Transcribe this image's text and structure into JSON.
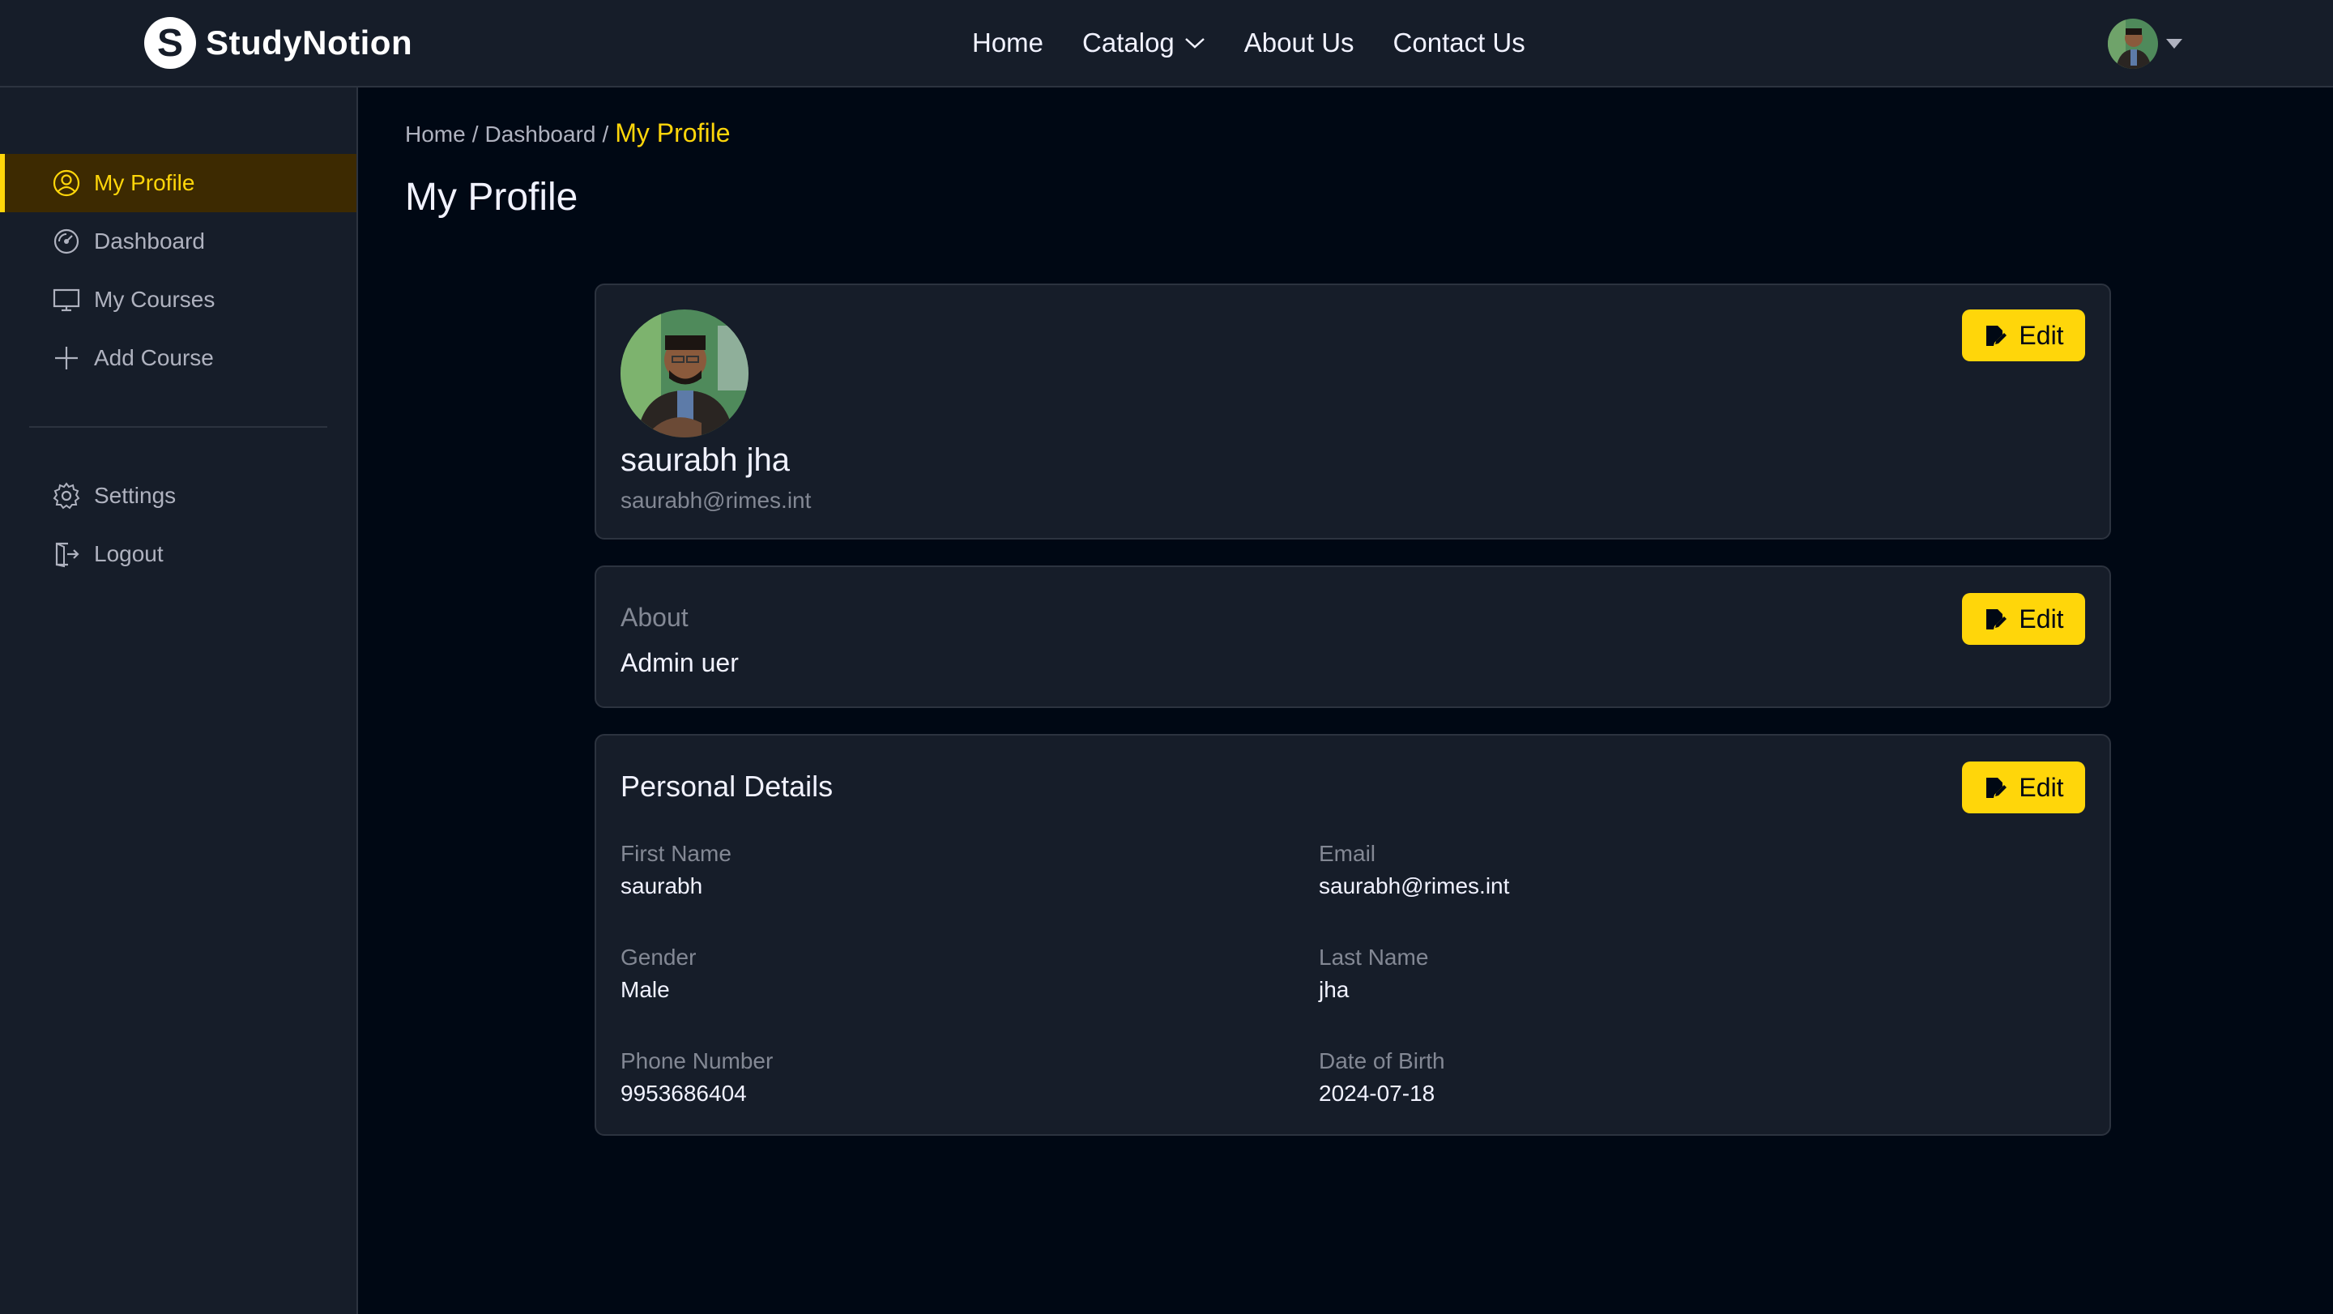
{
  "brand": {
    "logo_letter": "S",
    "name": "StudyNotion"
  },
  "nav": {
    "links": [
      "Home",
      "Catalog",
      "About Us",
      "Contact Us"
    ]
  },
  "sidebar": {
    "items": [
      {
        "label": "My Profile",
        "icon": "user-circle-icon",
        "active": true
      },
      {
        "label": "Dashboard",
        "icon": "gauge-icon"
      },
      {
        "label": "My Courses",
        "icon": "monitor-icon"
      },
      {
        "label": "Add Course",
        "icon": "plus-icon"
      }
    ],
    "bottom_items": [
      {
        "label": "Settings",
        "icon": "gear-icon"
      },
      {
        "label": "Logout",
        "icon": "logout-icon"
      }
    ]
  },
  "breadcrumb": {
    "items": [
      "Home",
      "Dashboard"
    ],
    "current": "My Profile",
    "separator": "/"
  },
  "page": {
    "title": "My Profile"
  },
  "profile": {
    "name": "saurabh jha",
    "email": "saurabh@rimes.int",
    "edit_label": "Edit"
  },
  "about": {
    "label": "About",
    "text": "Admin uer",
    "edit_label": "Edit"
  },
  "personal": {
    "title": "Personal Details",
    "edit_label": "Edit",
    "fields": [
      {
        "label": "First Name",
        "value": "saurabh"
      },
      {
        "label": "Email",
        "value": "saurabh@rimes.int"
      },
      {
        "label": "Gender",
        "value": "Male"
      },
      {
        "label": "Last Name",
        "value": "jha"
      },
      {
        "label": "Phone Number",
        "value": "9953686404"
      },
      {
        "label": "Date of Birth",
        "value": "2024-07-18"
      }
    ]
  },
  "colors": {
    "accent": "#FFD60A",
    "bg": "#000814",
    "panel": "#161D29",
    "border": "#2C333F",
    "muted": "#838894"
  }
}
